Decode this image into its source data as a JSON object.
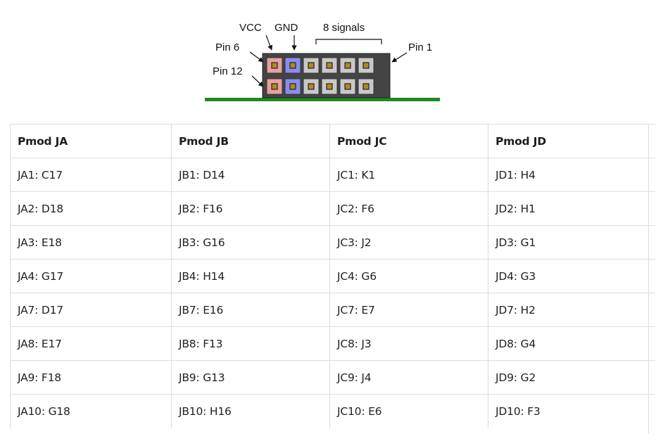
{
  "diagram": {
    "labels": {
      "vcc": "VCC",
      "gnd": "GND",
      "signals": "8 signals",
      "pin6": "Pin 6",
      "pin12": "Pin 12",
      "pin1": "Pin 1"
    },
    "colors": {
      "vcc_pin": "#e9a0a0",
      "gnd_pin": "#8a8ef0",
      "signal_pin": "#c9c9c9",
      "board": "#1f8a1f",
      "pad": "#b08a1e"
    }
  },
  "table": {
    "headers": [
      "Pmod JA",
      "Pmod JB",
      "Pmod JC",
      "Pmod JD"
    ],
    "rows": [
      [
        "JA1: C17",
        "JB1: D14",
        "JC1: K1",
        "JD1: H4"
      ],
      [
        "JA2: D18",
        "JB2: F16",
        "JC2: F6",
        "JD2: H1"
      ],
      [
        "JA3: E18",
        "JB3: G16",
        "JC3: J2",
        "JD3: G1"
      ],
      [
        "JA4: G17",
        "JB4: H14",
        "JC4: G6",
        "JD4: G3"
      ],
      [
        "JA7: D17",
        "JB7: E16",
        "JC7: E7",
        "JD7: H2"
      ],
      [
        "JA8: E17",
        "JB8: F13",
        "JC8: J3",
        "JD8: G4"
      ],
      [
        "JA9: F18",
        "JB9: G13",
        "JC9: J4",
        "JD9: G2"
      ],
      [
        "JA10: G18",
        "JB10: H16",
        "JC10: E6",
        "JD10: F3"
      ]
    ]
  }
}
